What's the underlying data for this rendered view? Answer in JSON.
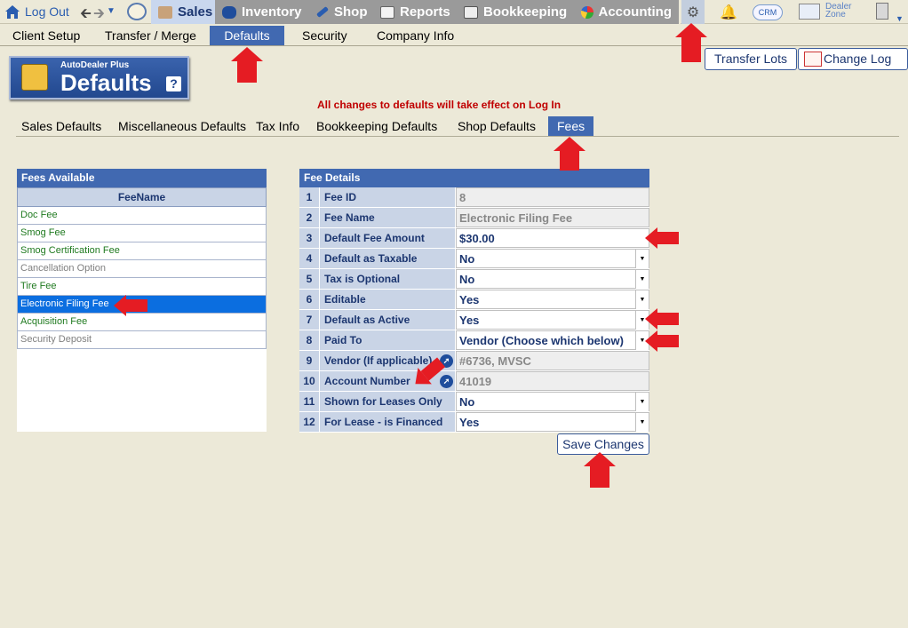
{
  "topbar": {
    "logout_label": "Log Out",
    "tabs": [
      {
        "label": "Sales",
        "icon": "salesperson-icon"
      },
      {
        "label": "Inventory",
        "icon": "car-icon"
      },
      {
        "label": "Shop",
        "icon": "wrench-icon"
      },
      {
        "label": "Reports",
        "icon": "report-icon"
      },
      {
        "label": "Bookkeeping",
        "icon": "book-icon"
      },
      {
        "label": "Accounting",
        "icon": "pie-chart-icon"
      }
    ],
    "crm_label": "CRM",
    "dealer_zone_label_1": "Dealer",
    "dealer_zone_label_2": "Zone"
  },
  "subnav": {
    "tabs": [
      "Client Setup",
      "Transfer / Merge",
      "Defaults",
      "Security",
      "Company Info"
    ],
    "active": "Defaults"
  },
  "actions": {
    "transfer_lots": "Transfer Lots",
    "change_log": "Change Log"
  },
  "logo": {
    "small": "AutoDealer Plus",
    "big": "Defaults",
    "help": "?"
  },
  "notice": "All changes to defaults will take effect on Log In",
  "defaults_tabs": [
    "Sales Defaults",
    "Miscellaneous Defaults",
    "Tax Info",
    "Bookkeeping Defaults",
    "Shop Defaults",
    "Fees"
  ],
  "fees_panel": {
    "title": "Fees Available",
    "column": "FeeName",
    "items": [
      {
        "name": "Doc Fee",
        "style": "green"
      },
      {
        "name": "Smog Fee",
        "style": "green"
      },
      {
        "name": "Smog Certification Fee",
        "style": "green"
      },
      {
        "name": "Cancellation Option",
        "style": "grey"
      },
      {
        "name": "Tire Fee",
        "style": "green"
      },
      {
        "name": "Electronic Filing Fee",
        "style": "selected"
      },
      {
        "name": "Acquisition Fee",
        "style": "green"
      },
      {
        "name": "Security Deposit",
        "style": "grey"
      }
    ]
  },
  "details_panel": {
    "title": "Fee Details",
    "rows": [
      {
        "num": "1",
        "label": "Fee ID",
        "value": "8",
        "kind": "readonly"
      },
      {
        "num": "2",
        "label": "Fee Name",
        "value": "Electronic Filing Fee",
        "kind": "readonly"
      },
      {
        "num": "3",
        "label": "Default Fee Amount",
        "value": "$30.00",
        "kind": "input"
      },
      {
        "num": "4",
        "label": "Default as Taxable",
        "value": "No",
        "kind": "select"
      },
      {
        "num": "5",
        "label": "Tax is Optional",
        "value": "No",
        "kind": "select"
      },
      {
        "num": "6",
        "label": "Editable",
        "value": "Yes",
        "kind": "select"
      },
      {
        "num": "7",
        "label": "Default as Active",
        "value": "Yes",
        "kind": "select"
      },
      {
        "num": "8",
        "label": "Paid To",
        "value": "Vendor (Choose which below)",
        "kind": "select"
      },
      {
        "num": "9",
        "label": "Vendor (If applicable)",
        "value": "#6736, MVSC",
        "kind": "readonly-link"
      },
      {
        "num": "10",
        "label": "Account Number",
        "value": "41019",
        "kind": "readonly-link"
      },
      {
        "num": "11",
        "label": "Shown for Leases Only",
        "value": "No",
        "kind": "select"
      },
      {
        "num": "12",
        "label": "For Lease - is Financed",
        "value": "Yes",
        "kind": "select"
      }
    ],
    "save_label": "Save Changes"
  },
  "colors": {
    "accent": "#4169b1",
    "header_bg": "#c9d4e6",
    "annotation_arrow": "#e51c23",
    "selected_row": "#0b6ee0",
    "green_text": "#1f7a1f"
  }
}
